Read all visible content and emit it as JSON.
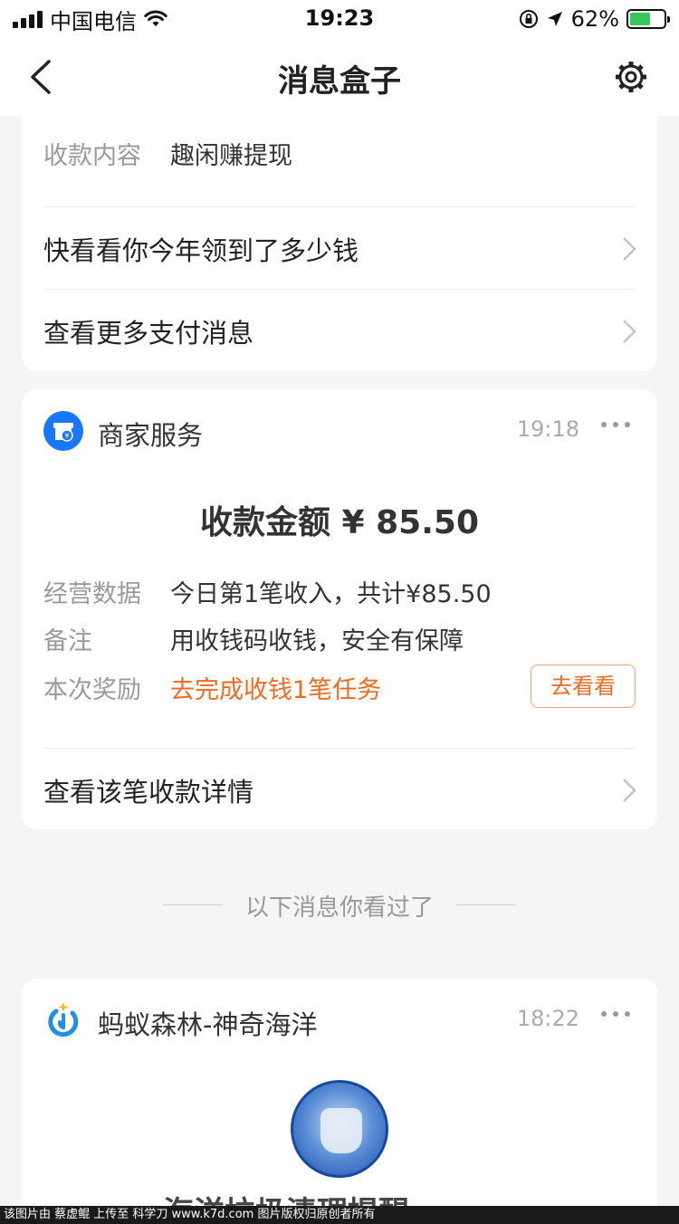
{
  "status_bar": {
    "carrier": "中国电信",
    "time": "19:23",
    "battery": "62%",
    "battery_level": 0.62
  },
  "nav": {
    "title": "消息盒子"
  },
  "payment_card": {
    "content_label": "收款内容",
    "content_value": "趣闲赚提现",
    "link_yearly": "快看看你今年领到了多少钱",
    "link_more": "查看更多支付消息"
  },
  "merchant_card": {
    "name": "商家服务",
    "time": "19:18",
    "amount_text": "收款金额 ¥ 85.50",
    "rows": [
      {
        "label": "经营数据",
        "value": "今日第1笔收入，共计¥85.50"
      },
      {
        "label": "备注",
        "value": "用收钱码收钱，安全有保障"
      },
      {
        "label": "本次奖励",
        "value": "去完成收钱1笔任务"
      }
    ],
    "action_button": "去看看",
    "link_detail": "查看该笔收款详情"
  },
  "seen_divider": "以下消息你看过了",
  "forest_card": {
    "name": "蚂蚁森林-神奇海洋",
    "time": "18:22",
    "cut_title": "海洋垃圾清理提醒"
  },
  "watermark": "该图片由 蔡虚鲲 上传至 科学刀 www.k7d.com 图片版权归原创者所有",
  "colors": {
    "accent_orange": "#f5681d",
    "merchant_blue": "#1677ff",
    "page_bg": "#f5f5f5"
  }
}
